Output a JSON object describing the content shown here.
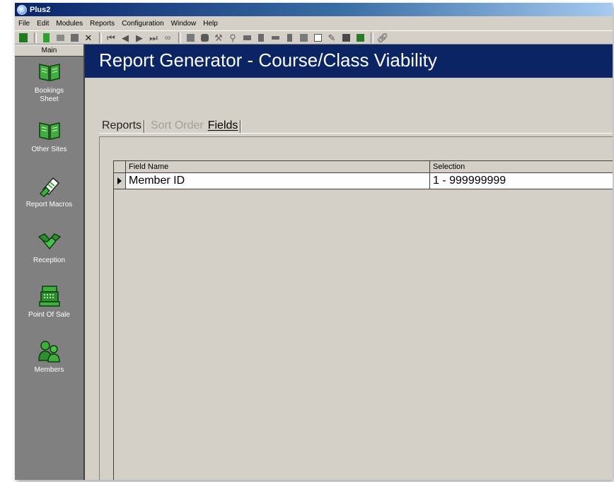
{
  "window": {
    "title": "Plus2"
  },
  "menu": [
    "File",
    "Edit",
    "Modules",
    "Reports",
    "Configuration",
    "Window",
    "Help"
  ],
  "toolbar": {
    "icons": [
      "exit-icon",
      "new-icon",
      "open-icon",
      "save-icon",
      "delete-icon",
      "first-record-icon",
      "previous-record-icon",
      "next-record-icon",
      "last-record-icon",
      "binoculars-icon",
      "copy-icon",
      "camera-icon",
      "tools-icon",
      "filter-icon",
      "list-icon",
      "report-icon",
      "bar-icon",
      "clipboard-icon",
      "chart-icon",
      "calendar-icon",
      "pen-icon",
      "calculator-icon",
      "export-icon",
      "link-icon"
    ]
  },
  "sidebar": {
    "header": "Main",
    "items": [
      {
        "label": "Bookings Sheet",
        "icon": "book-icon"
      },
      {
        "label": "Other Sites",
        "icon": "book-icon"
      },
      {
        "label": "Report Macros",
        "icon": "report-macro-icon"
      },
      {
        "label": "Reception",
        "icon": "handshake-icon"
      },
      {
        "label": "Point Of Sale",
        "icon": "cash-register-icon"
      },
      {
        "label": "Members",
        "icon": "members-icon"
      }
    ]
  },
  "main": {
    "title": "Report Generator - Course/Class Viability",
    "tabs": [
      {
        "label": "Reports",
        "state": "normal"
      },
      {
        "label": "Sort Order",
        "state": "disabled"
      },
      {
        "label": "Fields",
        "state": "active"
      }
    ],
    "grid": {
      "columns": [
        "Field Name",
        "Selection"
      ],
      "rows": [
        {
          "field_name": "Member ID",
          "selection": "1 - 999999999"
        }
      ]
    }
  },
  "colors": {
    "banner": "#0b2463",
    "sidebar": "#808080",
    "window_face": "#d4d0c8",
    "icon_green": "#2e9b2e"
  }
}
